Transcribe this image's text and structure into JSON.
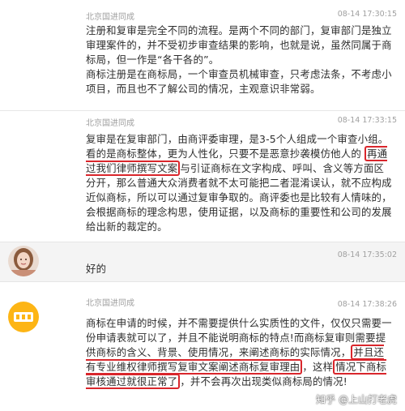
{
  "messages": [
    {
      "sender": "北京国进同成",
      "time": "08-14 17:30:15",
      "paragraphs": [
        "注册和复审是完全不同的流程。是两个不同的部门，复审部门是独立审理案件的，并不受初步审查结果的影响，也就是说，虽然同属于商标局，但一作是“各干各的”。",
        "商标注册是在商标局，一个审查员机械审查，只考虑法条，不考虑小项目，而且也不了解公司的情况，主观意识非常弱。"
      ]
    },
    {
      "sender": "北京国进同成",
      "time": "08-14 17:33:15",
      "text_before": "复审是在复审部门，由商评委审理，是3-5个人组成一个审查小组。看的是商标整体，更为人性化，只要不是恶意抄袭模仿他人的 ",
      "highlight": "再通过我们律师撰写文案",
      "text_after": "与引证商标在文字构成、呼叫、含义等方面区分开，那么普通大众消费者就不太可能把二者混淆误认，就不应构成近似商标，所以可以通过复审争取的。商评委也是比较有人情味的，会根据商标的理念构思，使用证据，以及商标的重要性和公司的发展给出新的裁定的。"
    },
    {
      "sender": "",
      "time": "08-14 17:35:02",
      "text": "好的"
    },
    {
      "sender": "北京国进同成",
      "time": "08-14 17:38:26",
      "text_before": "商标在申请的时候，并不需要提供什么实质性的文件，仅仅只需要一份申请表就可以了，并且不能说明商标的特点!而商标复审则需要提供商标的含义、背景、使用情况，来阐述商标的实际情况，",
      "highlight1": "并且还有专业维权律师撰写复审文案阐述商标复审理由",
      "text_middle": "，这样",
      "highlight2": "情况下商标审核通过就很正常了",
      "text_after": "，并不会再次出现类似商标局的情况!"
    }
  ],
  "watermark": "知乎 @上山打老虎"
}
